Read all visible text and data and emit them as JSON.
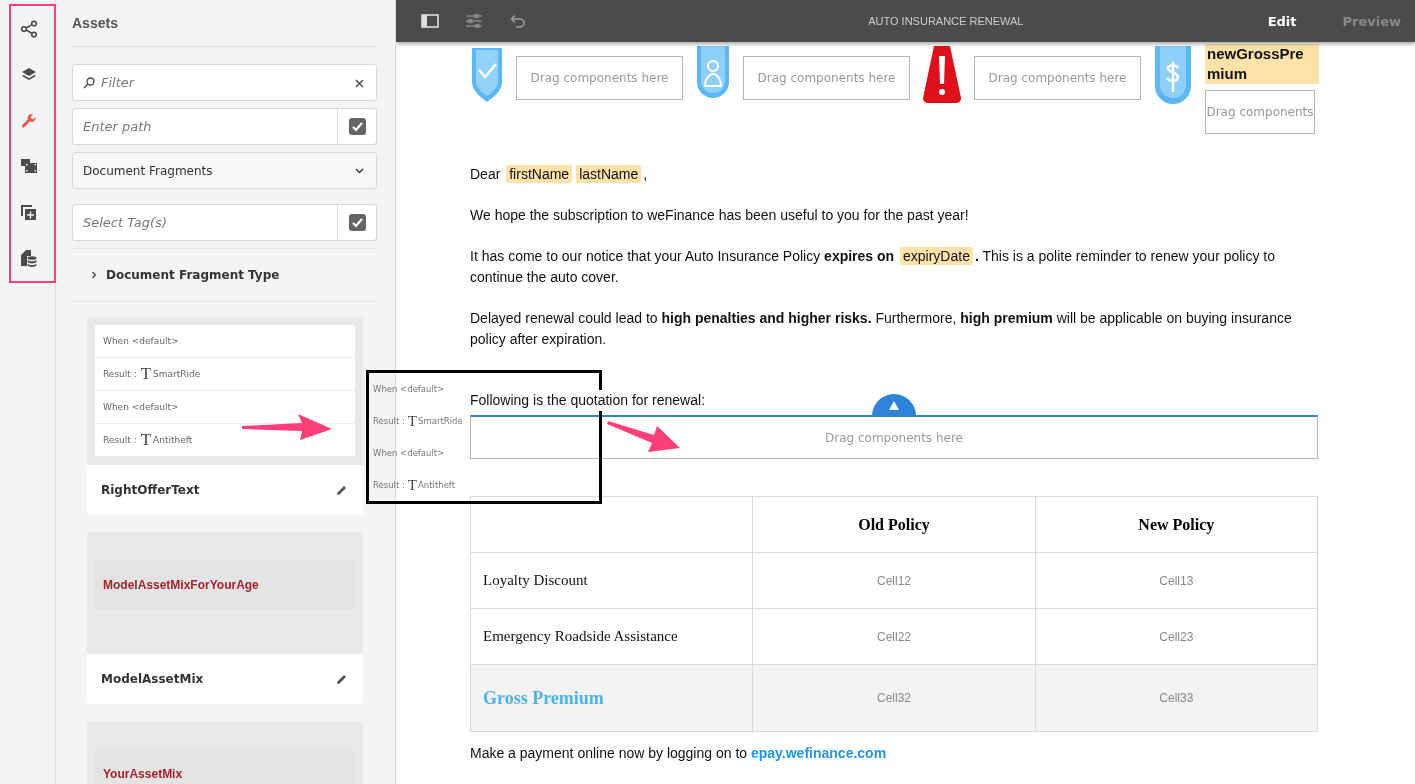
{
  "rail": {
    "items": [
      {
        "kind": "share",
        "selected": false
      },
      {
        "kind": "layers",
        "selected": false
      },
      {
        "kind": "wrench",
        "selected": true
      },
      {
        "kind": "media",
        "selected": false
      },
      {
        "kind": "add",
        "selected": false
      },
      {
        "kind": "data",
        "selected": false
      }
    ]
  },
  "assets": {
    "title": "Assets",
    "filter": {
      "placeholder": "Filter"
    },
    "path": {
      "placeholder": "Enter path",
      "checked": true
    },
    "type_select": {
      "value": "Document Fragments"
    },
    "tags": {
      "placeholder": "Select Tag(s)",
      "checked": true
    },
    "facet": {
      "label": "Document Fragment Type",
      "expanded": false
    },
    "cards": [
      {
        "kind": "condition",
        "rows": [
          {
            "kind": "when",
            "label": "When <default>"
          },
          {
            "kind": "result",
            "label": "Result :",
            "glyph": "T",
            "value": "SmartRide"
          },
          {
            "kind": "when",
            "label": "When <default>"
          },
          {
            "kind": "result",
            "label": "Result :",
            "glyph": "T",
            "value": "Antitheft"
          }
        ],
        "title": "RightOfferText"
      },
      {
        "kind": "text",
        "preview": "ModelAssetMixForYourAge",
        "title": "ModelAssetMix"
      },
      {
        "kind": "text",
        "preview": "YourAssetMix"
      }
    ]
  },
  "toolbar": {
    "title": "AUTO INSURANCE RENEWAL",
    "modes": [
      {
        "label": "Edit",
        "selected": true
      },
      {
        "label": "Preview",
        "selected": false
      }
    ]
  },
  "document": {
    "header_items": [
      {
        "kind": "shield",
        "drop": "Drag components here"
      },
      {
        "kind": "person",
        "drop": "Drag components here"
      },
      {
        "kind": "warning",
        "drop": "Drag components here"
      },
      {
        "kind": "dollar",
        "field": "newGrossPremium",
        "drop": "Drag components"
      }
    ],
    "paragraphs": [
      {
        "segments": [
          {
            "kind": "plain",
            "text": "Dear "
          },
          {
            "kind": "field",
            "text": "firstName"
          },
          {
            "kind": "field",
            "text": "lastName"
          },
          {
            "kind": "plain",
            "text": ","
          }
        ]
      },
      {
        "segments": [
          {
            "kind": "plain",
            "text": "We hope the subscription to weFinance has been useful to you for the past year!"
          }
        ]
      },
      {
        "segments": [
          {
            "kind": "plain",
            "text": "It has come to our notice that your Auto Insurance Policy "
          },
          {
            "kind": "bold",
            "text": "expires on "
          },
          {
            "kind": "field",
            "text": "expiryDate"
          },
          {
            "kind": "bold",
            "text": "."
          },
          {
            "kind": "plain",
            "text": " This is a polite reminder to renew your policy to continue the auto cover."
          }
        ]
      },
      {
        "segments": [
          {
            "kind": "plain",
            "text": "Delayed renewal could lead to "
          },
          {
            "kind": "bold",
            "text": "high penalties and higher risks."
          },
          {
            "kind": "plain",
            "text": " Furthermore, "
          },
          {
            "kind": "bold",
            "text": "high premium"
          },
          {
            "kind": "plain",
            "text": " will be applicable on buying insurance policy after expiration."
          }
        ]
      }
    ],
    "quotation": "Following is the quotation for renewal:",
    "drop_zone": "Drag components here",
    "table": {
      "columns": [
        "Old Policy",
        "New Policy"
      ],
      "rows": [
        {
          "label": "Loyalty Discount",
          "cells": [
            "Cell12",
            "Cell13"
          ],
          "highlight": false
        },
        {
          "label": "Emergency Roadside Assistance",
          "cells": [
            "Cell22",
            "Cell23"
          ],
          "highlight": false
        },
        {
          "label": "Gross Premium",
          "cells": [
            "Cell32",
            "Cell33"
          ],
          "highlight": true
        }
      ]
    },
    "footer": {
      "text": "Make a payment online now by logging on to ",
      "link": "epay.wefinance.com"
    }
  },
  "drag_preview": {
    "rows": [
      {
        "kind": "when",
        "label": "When <default>"
      },
      {
        "kind": "result",
        "label": "Result :",
        "glyph": "T",
        "value": "SmartRide"
      },
      {
        "kind": "when",
        "label": "When <default>"
      },
      {
        "kind": "result",
        "label": "Result :",
        "glyph": "T",
        "value": "Antitheft"
      }
    ]
  }
}
